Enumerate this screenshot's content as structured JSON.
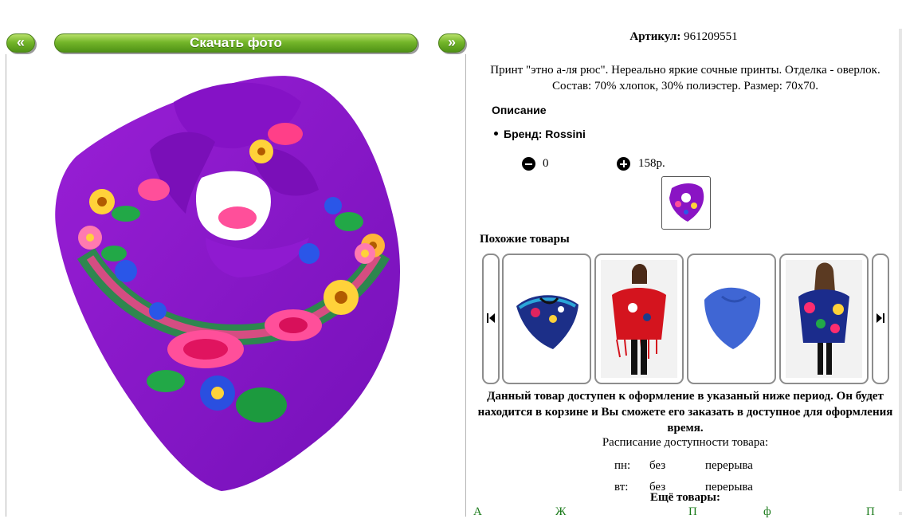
{
  "nav": {
    "prev_label": "«",
    "download_label": "Скачать фото",
    "next_label": "»"
  },
  "product": {
    "article_label": "Артикул:",
    "article_value": "961209551",
    "description": "Принт \"этно а-ля рюс\". Нереально яркие сочные принты. Отделка - оверлок. Состав: 70% хлопок, 30% полиэстер. Размер: 70x70.",
    "section_title": "Описание",
    "brand": "Бренд: Rossini",
    "quantity": "0",
    "price": "158р."
  },
  "similar": {
    "title": "Похожие товары",
    "items": [
      "blue-floral-scarf",
      "red-fringed-shawl",
      "blue-plain-scarf",
      "multicolor-shawl"
    ]
  },
  "availability": {
    "notice": "Данный товар доступен к оформление в указаный ниже период. Он будет находится в корзине и Вы сможете его заказать в доступное для оформления время.",
    "schedule_title": "Расписание доступности товара:",
    "rows": [
      {
        "day": "пн:",
        "from": "без",
        "to": "перерыва"
      },
      {
        "day": "вт:",
        "from": "без",
        "to": "перерыва"
      }
    ]
  },
  "more": {
    "title": "Ещё товары:",
    "links": [
      "А",
      "Ж",
      "П",
      "ф",
      "П"
    ]
  },
  "colors": {
    "accent_green": "#5ea321",
    "scarf_purple": "#8a14c4",
    "link_green": "#1a7a1a"
  }
}
